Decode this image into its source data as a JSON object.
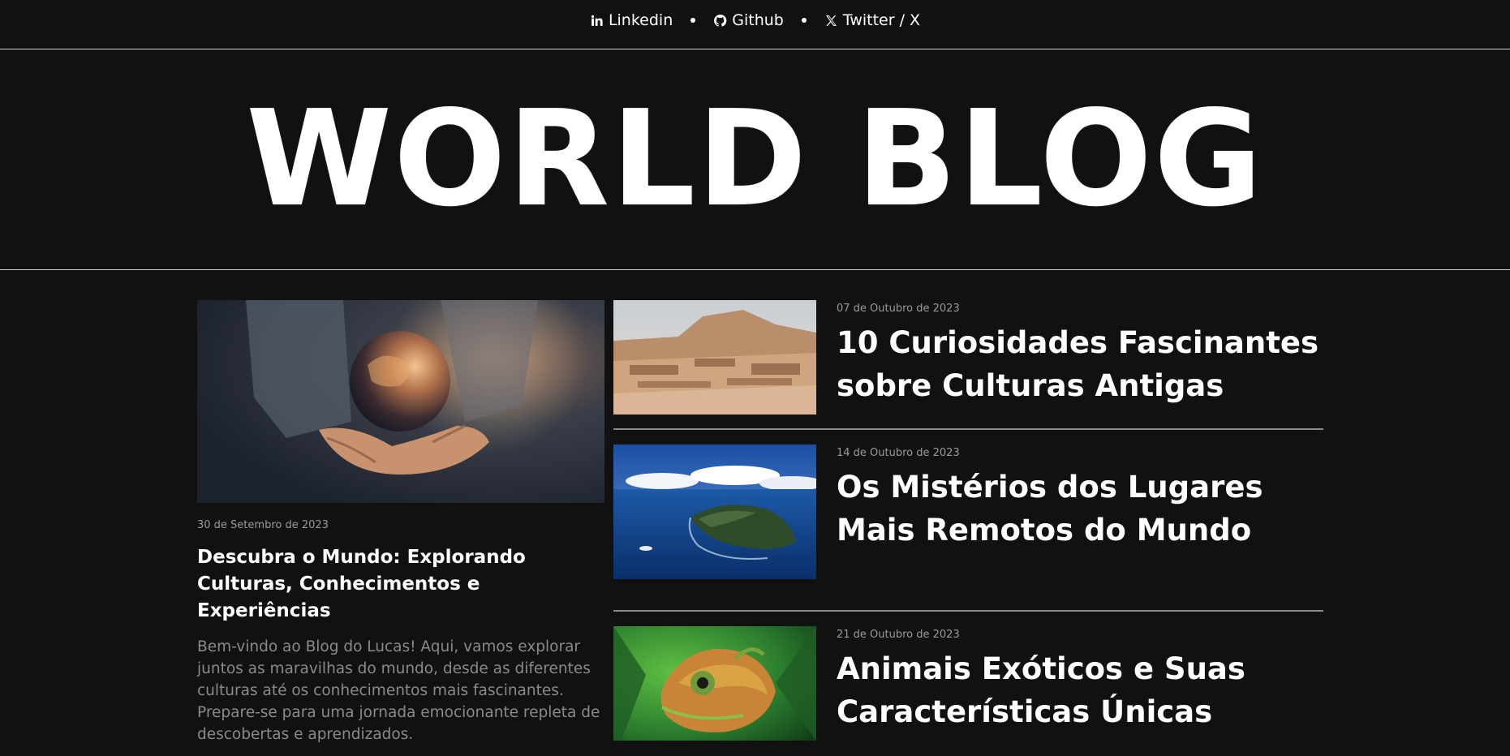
{
  "nav": {
    "links": [
      {
        "label": "Linkedin",
        "icon": "linkedin-icon"
      },
      {
        "label": "Github",
        "icon": "github-icon"
      },
      {
        "label": "Twitter / X",
        "icon": "x-icon"
      }
    ]
  },
  "hero": {
    "title": "WORLD BLOG"
  },
  "featured": {
    "image": "earth-in-hands-image",
    "date": "30 de Setembro de 2023",
    "title": "Descubra o Mundo: Explorando Culturas, Conhecimentos e Experiências",
    "excerpt": "Bem-vindo ao Blog do Lucas! Aqui, vamos explorar juntos as maravilhas do mundo, desde as diferentes culturas até os conhecimentos mais fascinantes. Prepare-se para uma jornada emocionante repleta de descobertas e aprendizados."
  },
  "posts": [
    {
      "image": "ancient-ruins-image",
      "date": "07 de Outubro de 2023",
      "title": "10 Curiosidades Fascinantes sobre Culturas Antigas"
    },
    {
      "image": "remote-island-image",
      "date": "14 de Outubro de 2023",
      "title": "Os Mistérios dos Lugares Mais Remotos do Mundo"
    },
    {
      "image": "chameleon-image",
      "date": "21 de Outubro de 2023",
      "title": "Animais Exóticos e Suas Características Únicas"
    }
  ]
}
